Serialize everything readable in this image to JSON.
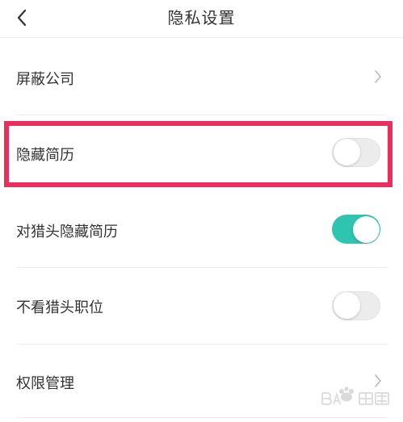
{
  "header": {
    "title": "隐私设置",
    "back_icon": "chevron-left-icon"
  },
  "settings": [
    {
      "label": "屏蔽公司",
      "control": "chevron"
    },
    {
      "label": "隐藏简历",
      "control": "toggle",
      "enabled": false,
      "highlighted": true
    },
    {
      "label": "对猎头隐藏简历",
      "control": "toggle",
      "enabled": true
    },
    {
      "label": "不看猎头职位",
      "control": "toggle",
      "enabled": false
    },
    {
      "label": "权限管理",
      "control": "chevron"
    }
  ],
  "colors": {
    "toggle_on": "#2ec4b0",
    "toggle_off": "#ececec",
    "highlight": "#ea2f5f"
  },
  "watermark_icon": "baidu-jingyan-logo"
}
